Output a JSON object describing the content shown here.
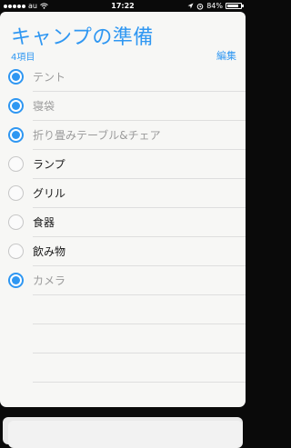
{
  "status_bar": {
    "carrier": "au",
    "time": "17:22",
    "battery_percent": "84%",
    "battery_level": 0.84,
    "icons": [
      "signal-dots",
      "wifi-icon",
      "location-icon",
      "alarm-icon",
      "battery-icon"
    ]
  },
  "list": {
    "title": "キャンプの準備",
    "count_label": "4項目",
    "edit_label": "編集",
    "accent_color": "#2f97f2",
    "items": [
      {
        "label": "テント",
        "checked": true
      },
      {
        "label": "寝袋",
        "checked": true
      },
      {
        "label": "折り畳みテーブル&チェア",
        "checked": true
      },
      {
        "label": "ランプ",
        "checked": false
      },
      {
        "label": "グリル",
        "checked": false
      },
      {
        "label": "食器",
        "checked": false
      },
      {
        "label": "飲み物",
        "checked": false
      },
      {
        "label": "カメラ",
        "checked": true
      }
    ]
  }
}
